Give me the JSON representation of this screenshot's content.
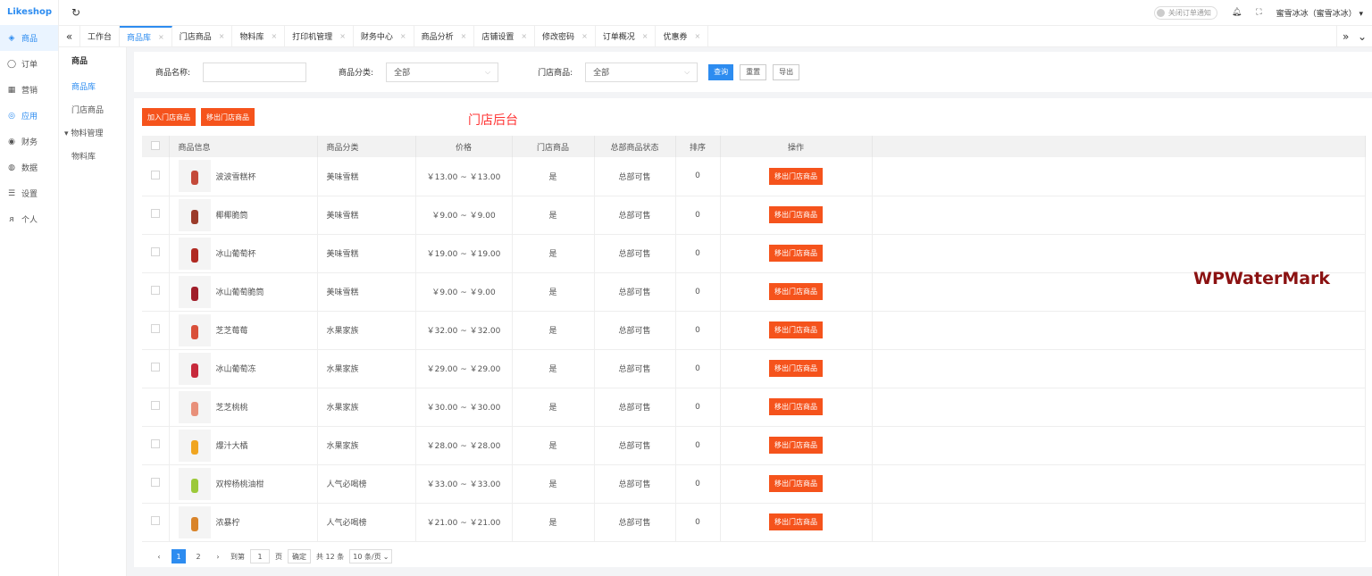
{
  "app": {
    "logo": "Likeshop"
  },
  "sidebar": {
    "items": [
      {
        "label": "商品",
        "icon": "◈",
        "active": true
      },
      {
        "label": "订单",
        "icon": "◯",
        "active": false
      },
      {
        "label": "营销",
        "icon": "▦",
        "active": false
      },
      {
        "label": "应用",
        "icon": "◎",
        "active": false
      },
      {
        "label": "财务",
        "icon": "◉",
        "active": false
      },
      {
        "label": "数据",
        "icon": "◍",
        "active": false
      },
      {
        "label": "设置",
        "icon": "☰",
        "active": false
      },
      {
        "label": "个人",
        "icon": "ᴙ",
        "active": false
      }
    ]
  },
  "header": {
    "notify_toggle_label": "关闭订单通知",
    "username": "蜜雪冰冰（蜜雪冰冰）"
  },
  "tabs": [
    {
      "label": "工作台",
      "closable": false
    },
    {
      "label": "商品库",
      "closable": true,
      "active": true
    },
    {
      "label": "门店商品",
      "closable": true
    },
    {
      "label": "物料库",
      "closable": true
    },
    {
      "label": "打印机管理",
      "closable": true
    },
    {
      "label": "财务中心",
      "closable": true
    },
    {
      "label": "商品分析",
      "closable": true
    },
    {
      "label": "店铺设置",
      "closable": true
    },
    {
      "label": "修改密码",
      "closable": true
    },
    {
      "label": "订单概况",
      "closable": true
    },
    {
      "label": "优惠券",
      "closable": true
    }
  ],
  "subnav": {
    "title": "商品",
    "item1": "商品库",
    "item2": "门店商品",
    "group": "物料管理",
    "item3": "物料库"
  },
  "filter": {
    "name_label": "商品名称:",
    "name_value": "",
    "category_label": "商品分类:",
    "category_value": "全部",
    "store_label": "门店商品:",
    "store_value": "全部",
    "query": "查询",
    "reset": "重置",
    "export": "导出"
  },
  "toolbar": {
    "add_label": "加入门店商品",
    "remove_label": "移出门店商品",
    "title": "门店后台"
  },
  "table": {
    "headers": [
      "",
      "商品信息",
      "商品分类",
      "价格",
      "门店商品",
      "总部商品状态",
      "排序",
      "操作"
    ],
    "action_label": "移出门店商品",
    "rows": [
      {
        "name": "波波雪糕杯",
        "category": "美味雪糕",
        "price": "￥13.00 ~ ￥13.00",
        "in_store": "是",
        "status": "总部可售",
        "sort": "0",
        "color": "#c44a3a"
      },
      {
        "name": "椰椰脆筒",
        "category": "美味雪糕",
        "price": "￥9.00 ~ ￥9.00",
        "in_store": "是",
        "status": "总部可售",
        "sort": "0",
        "color": "#9b3b2a"
      },
      {
        "name": "冰山葡萄杯",
        "category": "美味雪糕",
        "price": "￥19.00 ~ ￥19.00",
        "in_store": "是",
        "status": "总部可售",
        "sort": "0",
        "color": "#b02a22"
      },
      {
        "name": "冰山葡萄脆筒",
        "category": "美味雪糕",
        "price": "￥9.00 ~ ￥9.00",
        "in_store": "是",
        "status": "总部可售",
        "sort": "0",
        "color": "#a01e2a"
      },
      {
        "name": "芝芝莓莓",
        "category": "水果家族",
        "price": "￥32.00 ~ ￥32.00",
        "in_store": "是",
        "status": "总部可售",
        "sort": "0",
        "color": "#d9503a"
      },
      {
        "name": "冰山葡萄冻",
        "category": "水果家族",
        "price": "￥29.00 ~ ￥29.00",
        "in_store": "是",
        "status": "总部可售",
        "sort": "0",
        "color": "#c72a3c"
      },
      {
        "name": "芝芝桃桃",
        "category": "水果家族",
        "price": "￥30.00 ~ ￥30.00",
        "in_store": "是",
        "status": "总部可售",
        "sort": "0",
        "color": "#e8907a"
      },
      {
        "name": "爆汁大橘",
        "category": "水果家族",
        "price": "￥28.00 ~ ￥28.00",
        "in_store": "是",
        "status": "总部可售",
        "sort": "0",
        "color": "#f0a520"
      },
      {
        "name": "双榨杨桃油柑",
        "category": "人气必喝榜",
        "price": "￥33.00 ~ ￥33.00",
        "in_store": "是",
        "status": "总部可售",
        "sort": "0",
        "color": "#9cc93a"
      },
      {
        "name": "浓暴柠",
        "category": "人气必喝榜",
        "price": "￥21.00 ~ ￥21.00",
        "in_store": "是",
        "status": "总部可售",
        "sort": "0",
        "color": "#d9842a"
      }
    ]
  },
  "pagination": {
    "page1": "1",
    "page2": "2",
    "goto_label": "到第",
    "goto_value": "1",
    "page_unit": "页",
    "confirm": "确定",
    "total": "共 12 条",
    "page_size": "10 条/页"
  },
  "watermark": "WPWaterMark",
  "colors": {
    "accent": "#2d8cf0",
    "action": "#f5531c",
    "title_red": "#ff3333",
    "watermark": "#8b1212"
  }
}
